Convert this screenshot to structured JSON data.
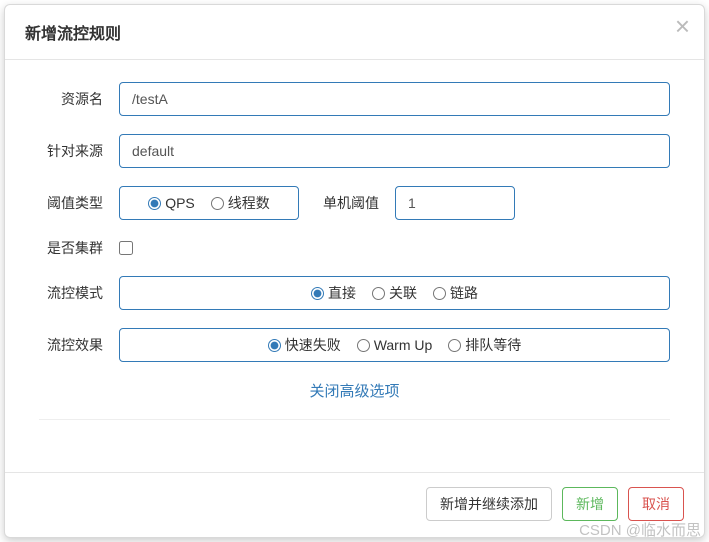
{
  "header": {
    "title": "新增流控规则",
    "close": "×"
  },
  "form": {
    "resource": {
      "label": "资源名",
      "value": "/testA"
    },
    "limitApp": {
      "label": "针对来源",
      "value": "default"
    },
    "thresholdType": {
      "label": "阈值类型",
      "options": {
        "qps": "QPS",
        "thread": "线程数"
      },
      "selected": "qps"
    },
    "threshold": {
      "label": "单机阈值",
      "value": "1"
    },
    "cluster": {
      "label": "是否集群",
      "checked": false
    },
    "mode": {
      "label": "流控模式",
      "options": {
        "direct": "直接",
        "relate": "关联",
        "chain": "链路"
      },
      "selected": "direct"
    },
    "effect": {
      "label": "流控效果",
      "options": {
        "fastfail": "快速失败",
        "warmup": "Warm Up",
        "queue": "排队等待"
      },
      "selected": "fastfail"
    },
    "advanced": "关闭高级选项"
  },
  "footer": {
    "addContinue": "新增并继续添加",
    "add": "新增",
    "cancel": "取消"
  },
  "watermark": "CSDN @临水而思"
}
